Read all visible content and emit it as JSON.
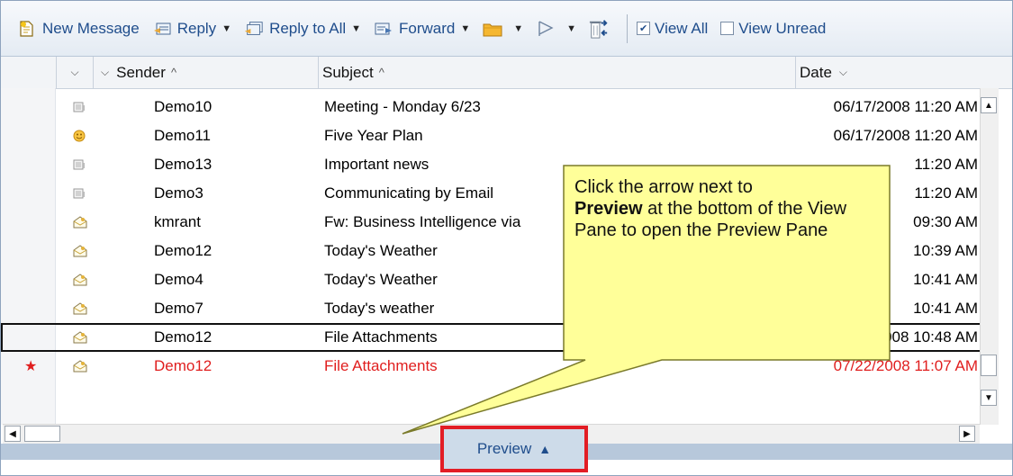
{
  "toolbar": {
    "new_message": "New Message",
    "reply": "Reply",
    "reply_all": "Reply to All",
    "forward": "Forward",
    "view_all": "View All",
    "view_unread": "View Unread"
  },
  "columns": {
    "sender": "Sender",
    "subject": "Subject",
    "date": "Date"
  },
  "messages": [
    {
      "sender": "Demo10",
      "subject": "Meeting - Monday 6/23",
      "date": "06/17/2008 11:20 AM",
      "icon": "meeting-icon"
    },
    {
      "sender": "Demo11",
      "subject": "Five Year Plan",
      "date": "06/17/2008 11:20 AM",
      "icon": "smiley-icon"
    },
    {
      "sender": "Demo13",
      "subject": "Important news",
      "date": "11:20 AM",
      "icon": "meeting-icon"
    },
    {
      "sender": "Demo3",
      "subject": "Communicating by Email",
      "date": "11:20 AM",
      "icon": "meeting-icon"
    },
    {
      "sender": "kmrant",
      "subject": "Fw:  Business Intelligence via",
      "date": "09:30 AM",
      "icon": "envelope-open-icon"
    },
    {
      "sender": "Demo12",
      "subject": "Today's Weather",
      "date": "10:39 AM",
      "icon": "envelope-open-icon"
    },
    {
      "sender": "Demo4",
      "subject": "Today's Weather",
      "date": "10:41 AM",
      "icon": "envelope-open-icon"
    },
    {
      "sender": "Demo7",
      "subject": "Today's weather",
      "date": "10:41 AM",
      "icon": "envelope-open-icon"
    },
    {
      "sender": "Demo12",
      "subject": "File Attachments",
      "date": "07/22/2008 10:48 AM",
      "icon": "envelope-open-icon",
      "selected": true
    },
    {
      "sender": "Demo12",
      "subject": "File Attachments",
      "date": "07/22/2008 11:07 AM",
      "icon": "envelope-open-icon",
      "flag": true
    }
  ],
  "preview": {
    "label": "Preview"
  },
  "callout": {
    "line1": "Click the arrow next to",
    "bold": "Preview",
    "line2": " at the bottom of the View Pane to open the Preview Pane"
  },
  "colors": {
    "accent": "#1f4d8c",
    "unread_red": "#e01e1e",
    "callout_fill": "#ffff99",
    "highlight_red": "#e21d25"
  }
}
